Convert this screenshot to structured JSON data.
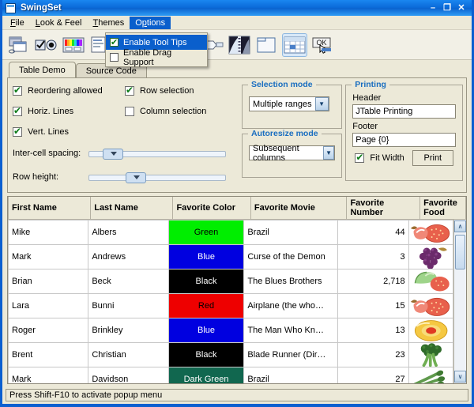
{
  "window": {
    "title": "SwingSet",
    "icon": "window-icon",
    "minimize": "–",
    "maximize": "❐",
    "close": "✕"
  },
  "menubar": {
    "items": [
      {
        "label": "File",
        "name": "menu-file"
      },
      {
        "label": "Look & Feel",
        "name": "menu-look-and-feel"
      },
      {
        "label": "Themes",
        "name": "menu-themes"
      },
      {
        "label": "Options",
        "name": "menu-options"
      }
    ]
  },
  "dropdown": {
    "items": [
      {
        "label": "Enable Tool Tips",
        "checked": true,
        "selected": true
      },
      {
        "label": "Enable Drag Support",
        "checked": false,
        "selected": false
      }
    ]
  },
  "toolbar": {
    "buttons": [
      {
        "name": "internal-frame-icon",
        "active": false
      },
      {
        "name": "option-pane-controls-icon",
        "active": false
      },
      {
        "name": "color-chooser-icon",
        "active": false
      },
      {
        "name": "list-icon",
        "active": false
      },
      {
        "name": "option-pane-icon",
        "active": false
      },
      {
        "name": "slider-icon",
        "active": false
      },
      {
        "name": "splitpane-icon",
        "active": false
      },
      {
        "name": "combo-box-icon",
        "active": false
      },
      {
        "name": "scroll-pane-icon",
        "active": false
      },
      {
        "name": "tabbed-pane-icon",
        "active": false
      },
      {
        "name": "table-icon",
        "active": true
      },
      {
        "name": "button-icon",
        "active": false
      }
    ]
  },
  "tabs": [
    {
      "label": "Table Demo",
      "selected": true
    },
    {
      "label": "Source Code",
      "selected": false
    }
  ],
  "controls": {
    "checkboxes": [
      {
        "label": "Reordering allowed",
        "checked": true,
        "name": "reordering-allowed-checkbox"
      },
      {
        "label": "Row selection",
        "checked": true,
        "name": "row-selection-checkbox"
      },
      {
        "label": "Horiz. Lines",
        "checked": true,
        "name": "horizontal-lines-checkbox"
      },
      {
        "label": "Column selection",
        "checked": false,
        "name": "column-selection-checkbox"
      },
      {
        "label": "Vert. Lines",
        "checked": true,
        "name": "vertical-lines-checkbox"
      }
    ],
    "sliders": [
      {
        "label": "Inter-cell spacing:",
        "value": 12,
        "name": "inter-cell-spacing-slider"
      },
      {
        "label": "Row height:",
        "value": 32,
        "name": "row-height-slider"
      }
    ]
  },
  "selection_mode": {
    "title": "Selection mode",
    "value": "Multiple ranges"
  },
  "autoresize_mode": {
    "title": "Autoresize mode",
    "value": "Subsequent columns"
  },
  "printing": {
    "title": "Printing",
    "header_label": "Header",
    "header_value": "JTable Printing",
    "footer_label": "Footer",
    "footer_value": "Page {0}",
    "fit_width_label": "Fit Width",
    "fit_width_checked": true,
    "print_label": "Print"
  },
  "table": {
    "columns": [
      "First Name",
      "Last Name",
      "Favorite Color",
      "Favorite Movie",
      "Favorite Number",
      "Favorite Food"
    ],
    "rows": [
      {
        "first": "Mike",
        "last": "Albers",
        "color": "Green",
        "color_hex": "#00ee00",
        "color_text": "#000000",
        "movie": "Brazil",
        "number": "44",
        "food": "strawberry"
      },
      {
        "first": "Mark",
        "last": "Andrews",
        "color": "Blue",
        "color_hex": "#0000e0",
        "color_text": "#ffffff",
        "movie": "Curse of the Demon",
        "number": "3",
        "food": "grapes"
      },
      {
        "first": "Brian",
        "last": "Beck",
        "color": "Black",
        "color_hex": "#000000",
        "color_text": "#ffffff",
        "movie": "The Blues Brothers",
        "number": "2,718",
        "food": "pepper"
      },
      {
        "first": "Lara",
        "last": "Bunni",
        "color": "Red",
        "color_hex": "#ee0000",
        "color_text": "#000000",
        "movie": "Airplane (the who…",
        "number": "15",
        "food": "strawberry"
      },
      {
        "first": "Roger",
        "last": "Brinkley",
        "color": "Blue",
        "color_hex": "#0000e0",
        "color_text": "#ffffff",
        "movie": "The Man Who Kn…",
        "number": "13",
        "food": "peach"
      },
      {
        "first": "Brent",
        "last": "Christian",
        "color": "Black",
        "color_hex": "#000000",
        "color_text": "#ffffff",
        "movie": "Blade Runner (Dir…",
        "number": "23",
        "food": "broccoli"
      },
      {
        "first": "Mark",
        "last": "Davidson",
        "color": "Dark Green",
        "color_hex": "#11674f",
        "color_text": "#ffffff",
        "movie": "Brazil",
        "number": "27",
        "food": "asparagus"
      }
    ],
    "scroll_up": "∧",
    "scroll_down": "∨"
  },
  "statusbar": {
    "text": "Press Shift-F10 to activate popup menu"
  },
  "colors": {
    "titlebar": "#0a6ad8",
    "accent": "#1a6ec0",
    "face": "#ece9d8",
    "menu_highlight": "#0a5fcc"
  }
}
